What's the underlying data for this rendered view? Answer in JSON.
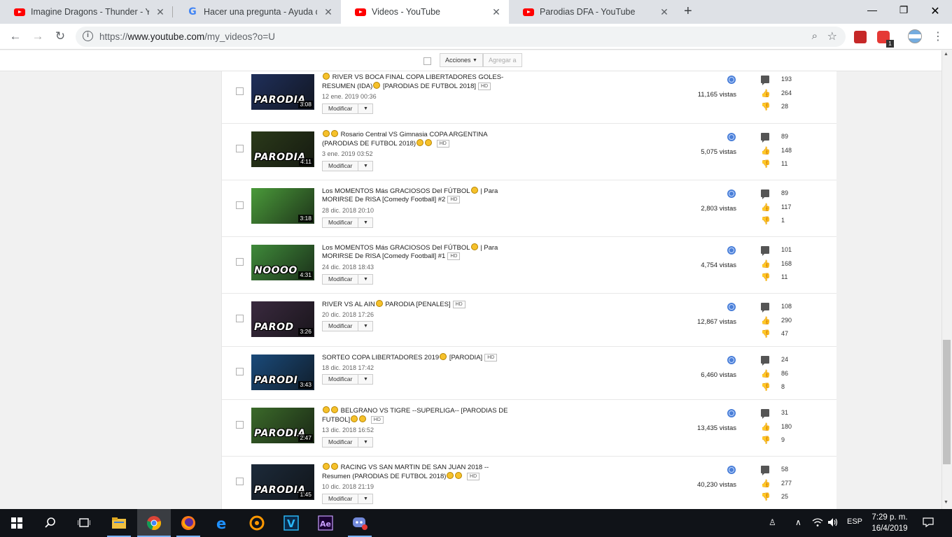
{
  "browser": {
    "tabs": [
      {
        "title": "Imagine Dragons - Thunder - You",
        "favicon": "youtube-icon"
      },
      {
        "title": "Hacer una pregunta - Ayuda de Y",
        "favicon": "google-icon"
      },
      {
        "title": "Videos - YouTube",
        "favicon": "youtube-icon",
        "active": true
      },
      {
        "title": "Parodias DFA - YouTube",
        "favicon": "youtube-icon"
      }
    ],
    "url_prefix": "https://",
    "url_host": "www.youtube.com",
    "url_path": "/my_videos?o=U",
    "window_controls": {
      "minimize": "—",
      "maximize": "❐",
      "close": "✕"
    },
    "extension_badge": "1"
  },
  "actions": {
    "actions_label": "Acciones",
    "add_label": "Agregar a"
  },
  "videos": [
    {
      "title": "RIVER VS BOCA FINAL COPA LIBERTADORES GOLES- RESUMEN (IDA)",
      "title_suffix": "[PARODIAS DE FUTBOL 2018]",
      "date": "12 ene. 2019 00:36",
      "duration": "3:08",
      "thumb_label": "PARODIA",
      "views": "11,165 vistas",
      "comments": "193",
      "likes": "264",
      "dislikes": "28",
      "modify_label": "Modificar",
      "hd": "HD",
      "lead_emoji": 1,
      "mid_emoji": 1,
      "thumb_color": "#1f2f5a"
    },
    {
      "title": "Rosario Central VS Gimnasia COPA ARGENTINA (PARODIAS DE FUTBOL 2018)",
      "title_suffix": "",
      "date": "3 ene. 2019 03:52",
      "duration": "4:11",
      "thumb_label": "PARODIA",
      "views": "5,075 vistas",
      "comments": "89",
      "likes": "148",
      "dislikes": "11",
      "modify_label": "Modificar",
      "hd": "HD",
      "lead_emoji": 2,
      "mid_emoji": 2,
      "thumb_color": "#2b3a1a"
    },
    {
      "title": "Los MOMENTOS Más GRACIOSOS Del FÚTBOL",
      "title_suffix": "| Para MORIRSE De RISA [Comedy Football] #2",
      "date": "28 dic. 2018 20:10",
      "duration": "3:18",
      "thumb_label": "",
      "views": "2,803 vistas",
      "comments": "89",
      "likes": "117",
      "dislikes": "1",
      "modify_label": "Modificar",
      "hd": "HD",
      "lead_emoji": 0,
      "mid_emoji": 1,
      "thumb_color": "#4a9a3a"
    },
    {
      "title": "Los MOMENTOS Más GRACIOSOS Del FÚTBOL",
      "title_suffix": "| Para MORIRSE De RISA [Comedy Football] #1",
      "date": "24 dic. 2018 18:43",
      "duration": "4:31",
      "thumb_label": "NOOOO",
      "views": "4,754 vistas",
      "comments": "101",
      "likes": "168",
      "dislikes": "11",
      "modify_label": "Modificar",
      "hd": "HD",
      "lead_emoji": 0,
      "mid_emoji": 1,
      "thumb_color": "#3f8a3a"
    },
    {
      "title": "RIVER VS AL AIN",
      "title_suffix": "PARODIA [PENALES]",
      "date": "20 dic. 2018 17:26",
      "duration": "3:26",
      "thumb_label": "PAROD",
      "views": "12,867 vistas",
      "comments": "108",
      "likes": "290",
      "dislikes": "47",
      "modify_label": "Modificar",
      "hd": "HD",
      "lead_emoji": 0,
      "mid_emoji": 1,
      "thumb_color": "#3a2a3f"
    },
    {
      "title": "SORTEO COPA LIBERTADORES 2019",
      "title_suffix": "[PARODIA]",
      "date": "18 dic. 2018 17:42",
      "duration": "3:43",
      "thumb_label": "PARODI",
      "views": "6,460 vistas",
      "comments": "24",
      "likes": "86",
      "dislikes": "8",
      "modify_label": "Modificar",
      "hd": "HD",
      "lead_emoji": 0,
      "mid_emoji": 1,
      "thumb_color": "#1a4a7a"
    },
    {
      "title": "BELGRANO VS TIGRE --SUPERLIGA-- [PARODIAS DE FUTBOL]",
      "title_suffix": "",
      "date": "13 dic. 2018 16:52",
      "duration": "2:47",
      "thumb_label": "PARODIA",
      "views": "13,435 vistas",
      "comments": "31",
      "likes": "180",
      "dislikes": "9",
      "modify_label": "Modificar",
      "hd": "HD",
      "lead_emoji": 2,
      "mid_emoji": 2,
      "thumb_color": "#3b6a2a"
    },
    {
      "title": "RACING VS SAN MARTIN DE SAN JUAN 2018 -- Resumen (PARODIAS DE FUTBOL 2018)",
      "title_suffix": "",
      "date": "10 dic. 2018 21:19",
      "duration": "1:45",
      "thumb_label": "PARODIA",
      "views": "40,230 vistas",
      "comments": "58",
      "likes": "277",
      "dislikes": "25",
      "modify_label": "Modificar",
      "hd": "HD",
      "lead_emoji": 2,
      "mid_emoji": 2,
      "thumb_color": "#1c2a3a"
    }
  ],
  "taskbar": {
    "language": "ESP",
    "time": "7:29 p. m.",
    "date": "16/4/2019"
  }
}
